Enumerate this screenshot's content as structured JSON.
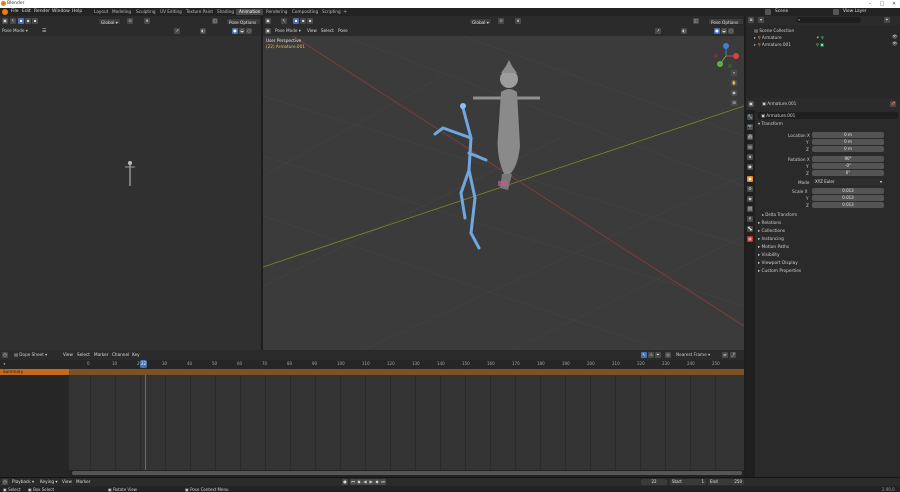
{
  "app": {
    "title": "Blender"
  },
  "menus": [
    "File",
    "Edit",
    "Render",
    "Window",
    "Help"
  ],
  "workspaces": [
    "Layout",
    "Modeling",
    "Sculpting",
    "UV Editing",
    "Texture Paint",
    "Shading",
    "Animation",
    "Rendering",
    "Compositing",
    "Scripting"
  ],
  "active_workspace": "Animation",
  "scene": "Scene",
  "view_layer": "View Layer",
  "left_viewport": {
    "mode": "Pose Mode",
    "orientation": "Global",
    "pose_options": "Pose Options"
  },
  "main_viewport": {
    "mode": "Pose Mode",
    "menus": [
      "View",
      "Select",
      "Pose"
    ],
    "orientation": "Global",
    "pose_options": "Pose Options",
    "info_line1": "User Perspective",
    "info_line2": "(22) Armature.001"
  },
  "outliner": {
    "collection": "Scene Collection",
    "items": [
      "Armature",
      "Armature.001"
    ]
  },
  "properties": {
    "object": "Armature.001",
    "object_field": "Armature.001",
    "section": "Transform",
    "location_label": "Location X",
    "location": [
      "0 m",
      "0 m",
      "0 m"
    ],
    "rotation_label": "Rotation X",
    "rotation": [
      "90°",
      "-0°",
      "0°"
    ],
    "mode_label": "Mode",
    "mode": "XYZ Euler",
    "scale_label": "Scale X",
    "scale": [
      "0.013",
      "0.013",
      "0.013"
    ],
    "axis_y": "Y",
    "axis_z": "Z",
    "delta": "Delta Transform",
    "collapsed": [
      "Relations",
      "Collections",
      "Instancing",
      "Motion Paths",
      "Visibility",
      "Viewport Display",
      "Custom Properties"
    ]
  },
  "dopesheet": {
    "editor": "Dope Sheet",
    "menus": [
      "View",
      "Select",
      "Marker",
      "Channel",
      "Key"
    ],
    "summary": "Summary",
    "current_frame": "22",
    "frame_ticks": [
      "0",
      "10",
      "20",
      "30",
      "40",
      "50",
      "60",
      "70",
      "80",
      "90",
      "100",
      "110",
      "120",
      "130",
      "140",
      "150",
      "160",
      "170",
      "180",
      "190",
      "200",
      "210",
      "220",
      "230",
      "240",
      "250"
    ],
    "keying_mode": "Nearest Frame"
  },
  "timeline": {
    "menus": [
      "Playback",
      "Keying",
      "View",
      "Marker"
    ],
    "frame": "22",
    "start_label": "Start",
    "start": "1",
    "end_label": "End",
    "end": "250"
  },
  "status": {
    "select": "Select",
    "box_select": "Box Select",
    "rotate": "Rotate View",
    "pose_menu": "Pose Context Menu",
    "version": "2.90.0"
  }
}
